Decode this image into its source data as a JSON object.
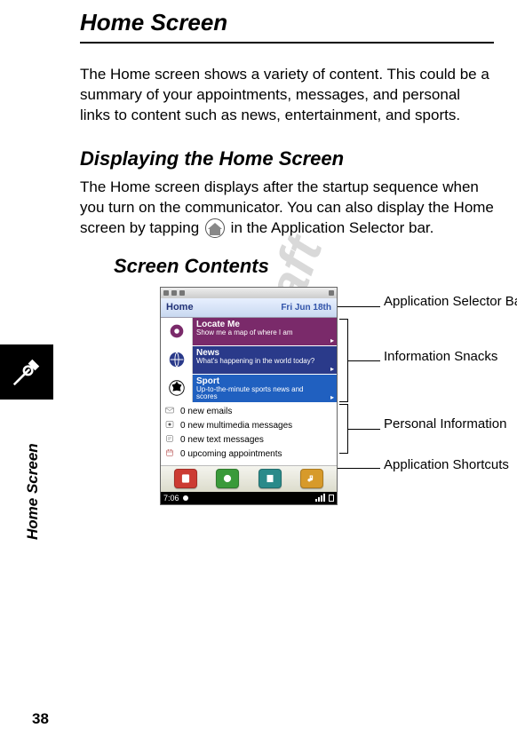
{
  "title": "Home Screen",
  "intro": "The Home screen shows a variety of content. This could be a summary of your appointments, messages, and personal links to content such as news, entertainment, and sports.",
  "section2_title": "Displaying the Home Screen",
  "section2_intro_a": "The Home screen displays after the startup sequence when you turn on the communicator. You can also display the Home screen by tapping",
  "section2_intro_b": "in the Application Selector bar.",
  "section3_title": "Screen Contents",
  "watermark": "Draft",
  "sidebar_label": "Home Screen",
  "page_number": "38",
  "device": {
    "app_label": "Home",
    "date": "Fri Jun 18th",
    "snacks": [
      {
        "key": "locate",
        "title": "Locate Me",
        "sub": "Show me a map of where I am"
      },
      {
        "key": "news",
        "title": "News",
        "sub": "What's happening in the world today?"
      },
      {
        "key": "sport",
        "title": "Sport",
        "sub": "Up-to-the-minute sports news and scores"
      }
    ],
    "personal": [
      "0 new emails",
      "0 new multimedia messages",
      "0 new text messages",
      "0 upcoming appointments"
    ],
    "time": "7:06"
  },
  "callouts": {
    "selector_bar": "Application Selector Bar",
    "info_snacks": "Information Snacks",
    "personal_info": "Personal Information",
    "shortcuts": "Application Shortcuts"
  }
}
